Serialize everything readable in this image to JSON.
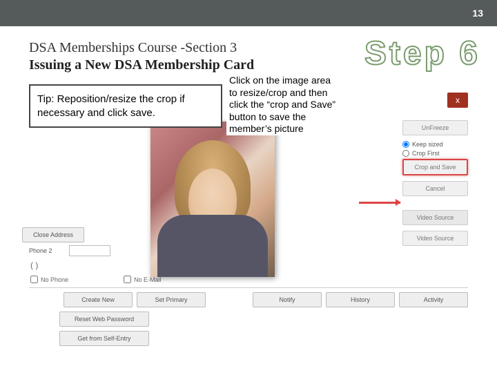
{
  "page_number": "13",
  "header": {
    "course_title": "DSA Memberships Course -Section 3",
    "subtitle": "Issuing a New DSA Membership Card",
    "step_label": "Step 6"
  },
  "tip_box": "Tip:  Reposition/resize the crop if necessary and click save.",
  "instruction": "Click on the image area to resize/crop and then click the “crop and Save” button to save the member’s picture",
  "right_panel": {
    "close": "x",
    "btn_unfreeze": "UnFreeze",
    "radio_keep": "Keep sized",
    "radio_crop": "Crop First",
    "btn_crop_save": "Crop and Save",
    "btn_cancel": "Cancel",
    "label_video": "Video Source",
    "btn_video": "Video Source"
  },
  "lower_form": {
    "label_close_addr": "Close Address",
    "label_phone2": "Phone 2",
    "paren": "(  )",
    "check_nophone": "No Phone",
    "check_nomail": "No E-Mail",
    "btn_create": "Create New",
    "btn_setprimary": "Set Primary",
    "btn_notify": "Notify",
    "btn_history": "History",
    "btn_activity": "Activity",
    "btn_reset": "Reset Web Password",
    "btn_selfentry": "Get from Self-Entry"
  }
}
